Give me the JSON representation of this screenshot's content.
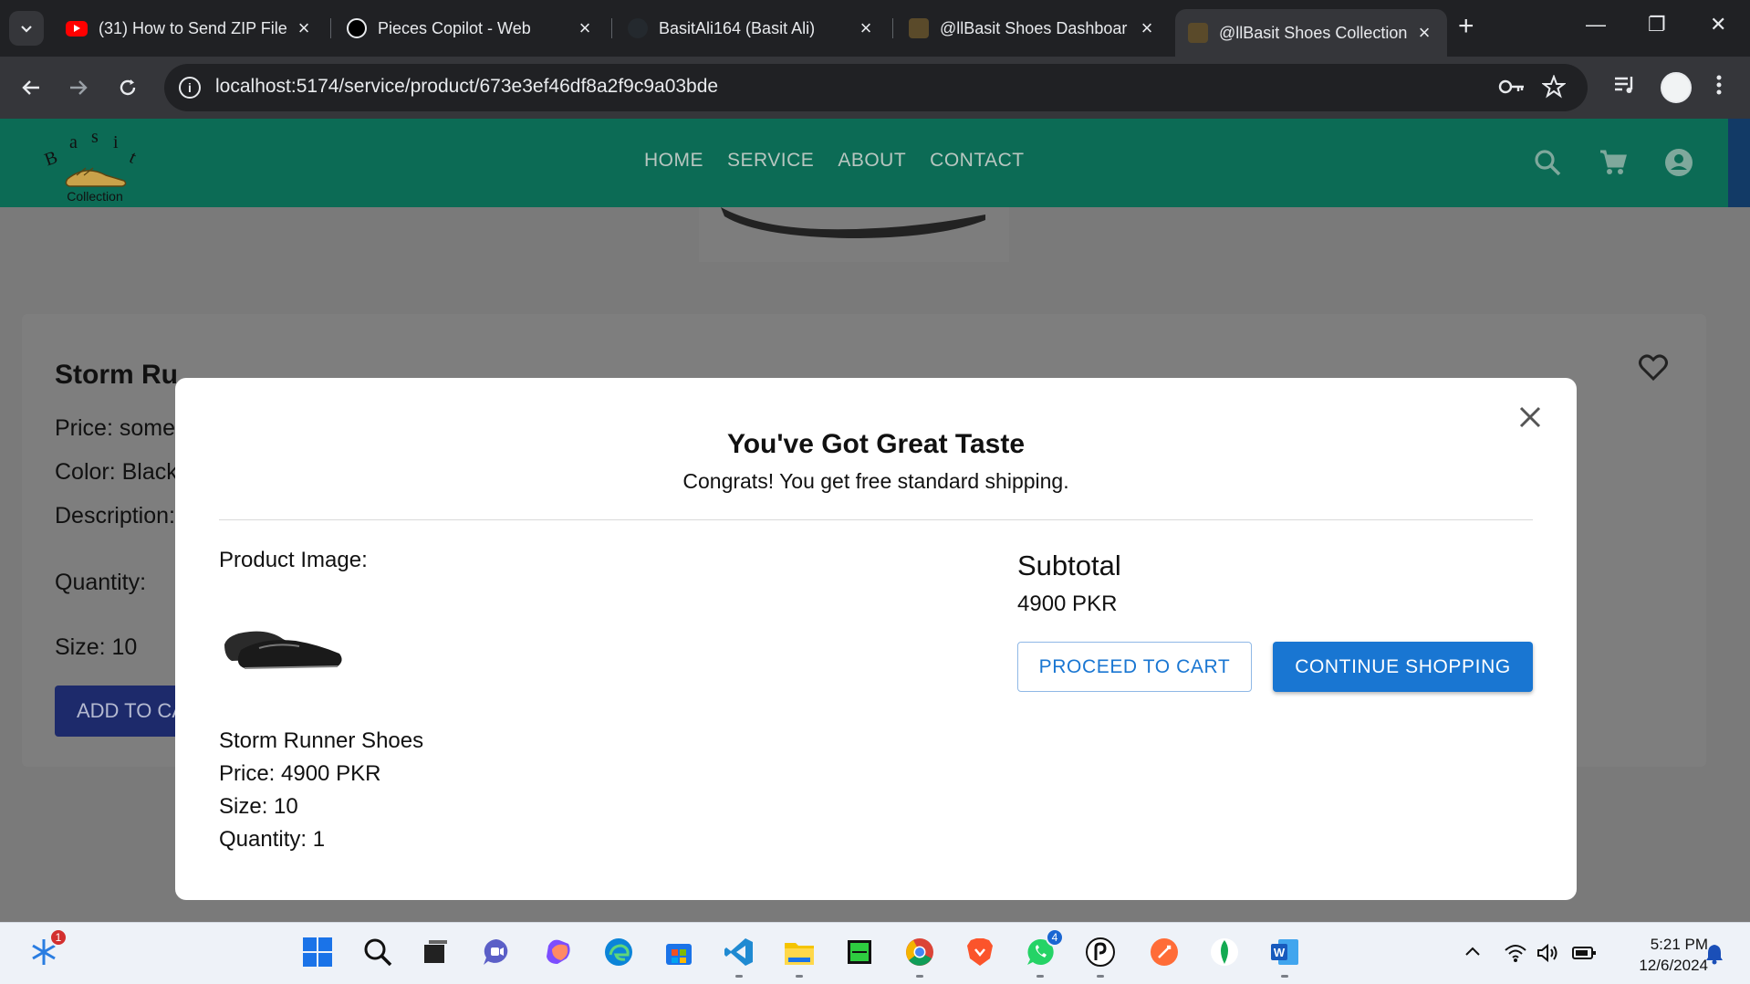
{
  "browser": {
    "tabs": [
      {
        "title": "(31) How to Send ZIP File",
        "favicon": "youtube-icon",
        "active": false
      },
      {
        "title": "Pieces Copilot - Web",
        "favicon": "pieces-icon",
        "active": false
      },
      {
        "title": "BasitAli164 (Basit Ali)",
        "favicon": "github-icon",
        "active": false
      },
      {
        "title": "@llBasit Shoes Dashboar",
        "favicon": "basit-logo-icon",
        "active": false
      },
      {
        "title": "@llBasit Shoes Collection",
        "favicon": "basit-logo-icon",
        "active": true
      }
    ],
    "url": "localhost:5174/service/product/673e3ef46df8a2f9c9a03bde"
  },
  "site": {
    "logo_text": "Basit",
    "logo_subtext": "Collection",
    "nav": [
      "HOME",
      "SERVICE",
      "ABOUT",
      "CONTACT"
    ],
    "brand_color": "#0c6b55"
  },
  "product_page": {
    "title": "Storm Ru",
    "price_line": "Price: somet",
    "color_line": "Color: Black",
    "description_line": "Description:",
    "quantity_label": "Quantity:",
    "size_line": "Size: 10",
    "add_to_cart_label": "ADD TO CA"
  },
  "modal": {
    "title": "You've Got Great Taste",
    "subtitle": "Congrats! You get free standard shipping.",
    "product_image_label": "Product Image:",
    "product_name": "Storm Runner Shoes",
    "price": "Price: 4900 PKR",
    "size": "Size: 10",
    "quantity": "Quantity: 1",
    "subtotal_label": "Subtotal",
    "subtotal_value": "4900 PKR",
    "proceed_label": "PROCEED TO CART",
    "continue_label": "CONTINUE SHOPPING",
    "accent_color": "#1976d2"
  },
  "taskbar": {
    "widgets_badge": "1",
    "whatsapp_badge": "4",
    "time": "5:21 PM",
    "date": "12/6/2024"
  }
}
